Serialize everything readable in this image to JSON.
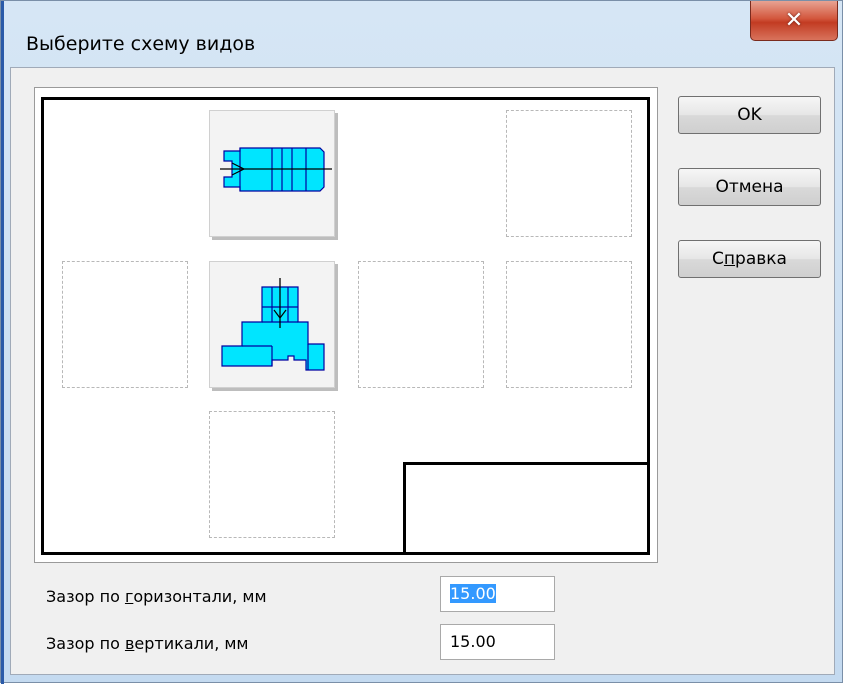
{
  "window": {
    "title": "Выберите схему видов",
    "close_glyph": "✕"
  },
  "buttons": {
    "ok_label": "OK",
    "cancel_label": "Отмена",
    "help_label": "Справка"
  },
  "fields": {
    "horizontal_gap": {
      "label_prefix": "Зазор по ",
      "label_accel": "г",
      "label_suffix": "оризонтали, мм",
      "value": "15.00",
      "selected": true
    },
    "vertical_gap": {
      "label_prefix": "Зазор по ",
      "label_accel": "в",
      "label_suffix": "ертикали, мм",
      "value": "15.00"
    }
  },
  "layout_grid": {
    "views": [
      {
        "name": "view-top",
        "state": "filled"
      },
      {
        "name": "view-top-right",
        "state": "empty"
      },
      {
        "name": "view-left",
        "state": "empty"
      },
      {
        "name": "view-front",
        "state": "filled"
      },
      {
        "name": "view-right",
        "state": "empty"
      },
      {
        "name": "view-far-right",
        "state": "empty"
      },
      {
        "name": "view-bottom",
        "state": "empty"
      }
    ]
  },
  "colors": {
    "part_fill": "#00e5ff",
    "part_stroke": "#0000a0",
    "close_button": "#c9432b",
    "selection": "#3399ff"
  }
}
